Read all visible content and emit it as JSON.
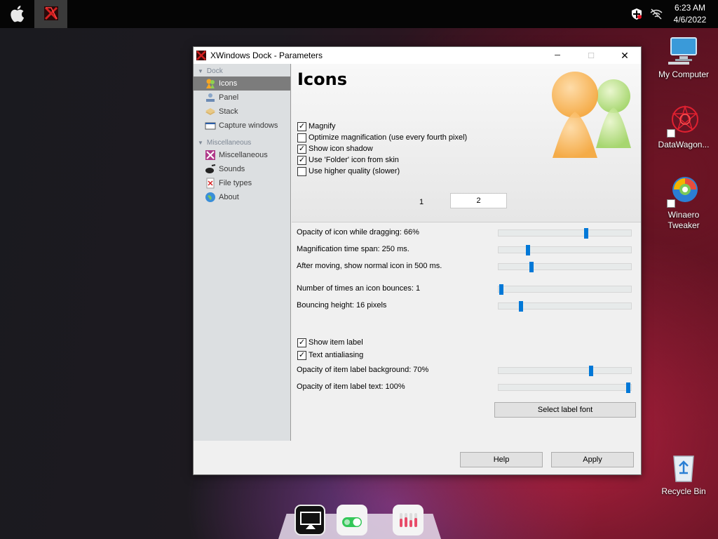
{
  "menubar": {
    "clock_time": "6:23 AM",
    "clock_date": "4/6/2022",
    "icons": [
      "apple-logo-icon",
      "xwindows-dock-icon",
      "security-shield-icon",
      "network-offline-icon"
    ]
  },
  "desktop": {
    "icons": [
      {
        "label": "My Computer",
        "icon": "computer-icon"
      },
      {
        "label": "DataWagon...",
        "icon": "datawagon-icon"
      },
      {
        "label": "Winaero Tweaker",
        "icon": "winaero-tweaker-icon"
      },
      {
        "label": "Recycle Bin",
        "icon": "recycle-bin-icon"
      }
    ]
  },
  "window": {
    "title": "XWindows Dock - Parameters",
    "controls": {
      "minimize": "─",
      "maximize": "☐",
      "close": "✕"
    }
  },
  "sidebar": {
    "groups": [
      {
        "label": "Dock",
        "items": [
          {
            "label": "Icons",
            "selected": true
          },
          {
            "label": "Panel"
          },
          {
            "label": "Stack"
          },
          {
            "label": "Capture windows"
          }
        ]
      },
      {
        "label": "Miscellaneous",
        "items": [
          {
            "label": "Miscellaneous"
          },
          {
            "label": "Sounds"
          },
          {
            "label": "File types"
          },
          {
            "label": "About"
          }
        ]
      }
    ]
  },
  "content": {
    "title": "Icons",
    "checkboxes": [
      {
        "label": "Magnify",
        "checked": true
      },
      {
        "label": "Optimize magnification (use every fourth pixel)",
        "checked": false
      },
      {
        "label": "Show icon shadow",
        "checked": true
      },
      {
        "label": "Use 'Folder' icon from skin",
        "checked": true
      },
      {
        "label": "Use higher quality (slower)",
        "checked": false
      }
    ],
    "pager": {
      "page1": "1",
      "page2": "2",
      "current": 2
    },
    "sliders": [
      {
        "label": "Opacity of icon while dragging: 66%",
        "value": 0.66
      },
      {
        "label": "Magnification time span: 250 ms.",
        "value": 0.22
      },
      {
        "label": "After moving, show normal icon in 500 ms.",
        "value": 0.25
      },
      {
        "label": "Number of times an icon bounces: 1",
        "value": 0.0
      },
      {
        "label": "Bouncing height: 16 pixels",
        "value": 0.17
      }
    ],
    "label_checkboxes": [
      {
        "label": "Show item label",
        "checked": true
      },
      {
        "label": "Text antialiasing",
        "checked": true
      }
    ],
    "label_sliders": [
      {
        "label": "Opacity of item label background: 70%",
        "value": 0.7
      },
      {
        "label": "Opacity of item label text: 100%",
        "value": 1.0
      }
    ],
    "select_font_button": "Select label font"
  },
  "footer": {
    "help_button": "Help",
    "apply_button": "Apply"
  },
  "dock": {
    "items": [
      "airplay-icon",
      "toggle-switch-app-icon",
      "test-tubes-app-icon"
    ]
  }
}
